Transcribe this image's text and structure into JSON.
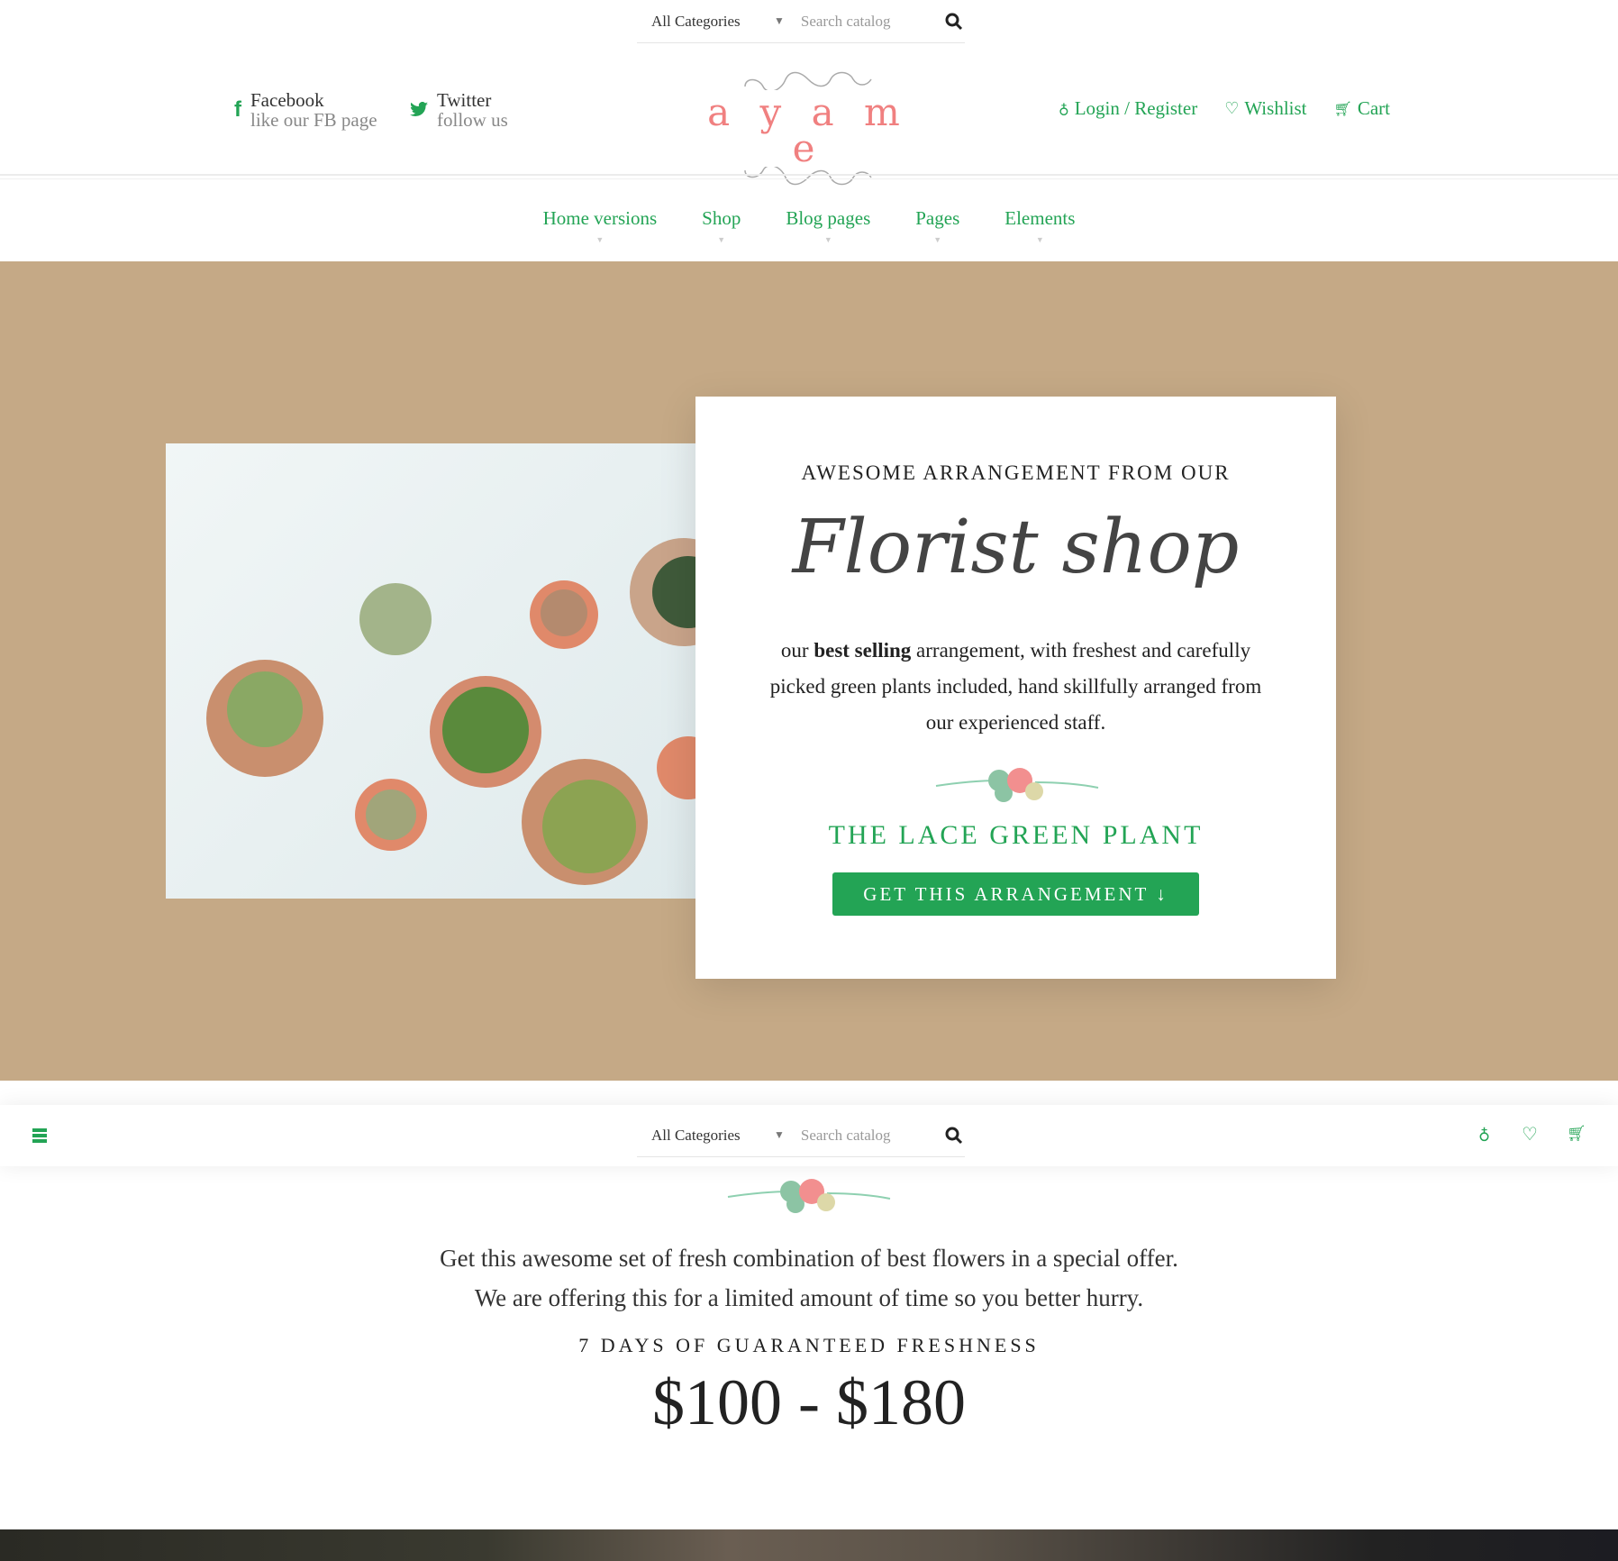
{
  "search": {
    "category": "All Categories",
    "placeholder": "Search catalog"
  },
  "social": [
    {
      "name": "Facebook",
      "sub": "like our FB page"
    },
    {
      "name": "Twitter",
      "sub": "follow us"
    }
  ],
  "logo": {
    "text": "a y a m e"
  },
  "account": {
    "login": "Login / Register",
    "wishlist": "Wishlist",
    "cart": "Cart"
  },
  "nav": [
    {
      "label": "Home versions"
    },
    {
      "label": "Shop"
    },
    {
      "label": "Blog pages"
    },
    {
      "label": "Pages"
    },
    {
      "label": "Elements"
    }
  ],
  "hero": {
    "kicker": "AWESOME ARRANGEMENT FROM OUR",
    "script_title": "Florist shop",
    "desc_pre": "our ",
    "desc_bold": "best selling",
    "desc_post": " arrangement, with freshest and carefully picked green plants included, hand skillfully arranged from our experienced staff.",
    "product": "THE LACE GREEN PLANT",
    "cta": "GET THIS ARRANGEMENT ↓"
  },
  "offer": {
    "line1": "Get this awesome set of fresh combination of best flowers in a special offer.",
    "line2": "We are offering this for a limited amount of time so you better hurry.",
    "freshness": "7 DAYS OF GUARANTEED FRESHNESS",
    "price": "$100 - $180"
  },
  "colors": {
    "accent": "#23a455",
    "hero_bg": "#c5a986",
    "logo": "#f08080"
  }
}
